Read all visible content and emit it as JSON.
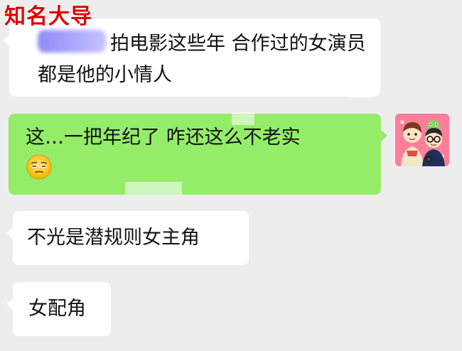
{
  "watermark": {
    "text": "知名大导"
  },
  "messages": [
    {
      "direction": "incoming",
      "text": "拍电影这些年 合作过的女演员都是他的小情人"
    },
    {
      "direction": "outgoing",
      "text": "这…一把年纪了 咋还这么不老实",
      "emoji": "unamused-face"
    },
    {
      "direction": "incoming",
      "text": "不光是潜规则女主角"
    },
    {
      "direction": "incoming",
      "text": "女配角"
    }
  ],
  "colors": {
    "background": "#ededed",
    "incoming_bubble": "#ffffff",
    "outgoing_bubble": "#95ec69",
    "watermark": "#e00000"
  }
}
